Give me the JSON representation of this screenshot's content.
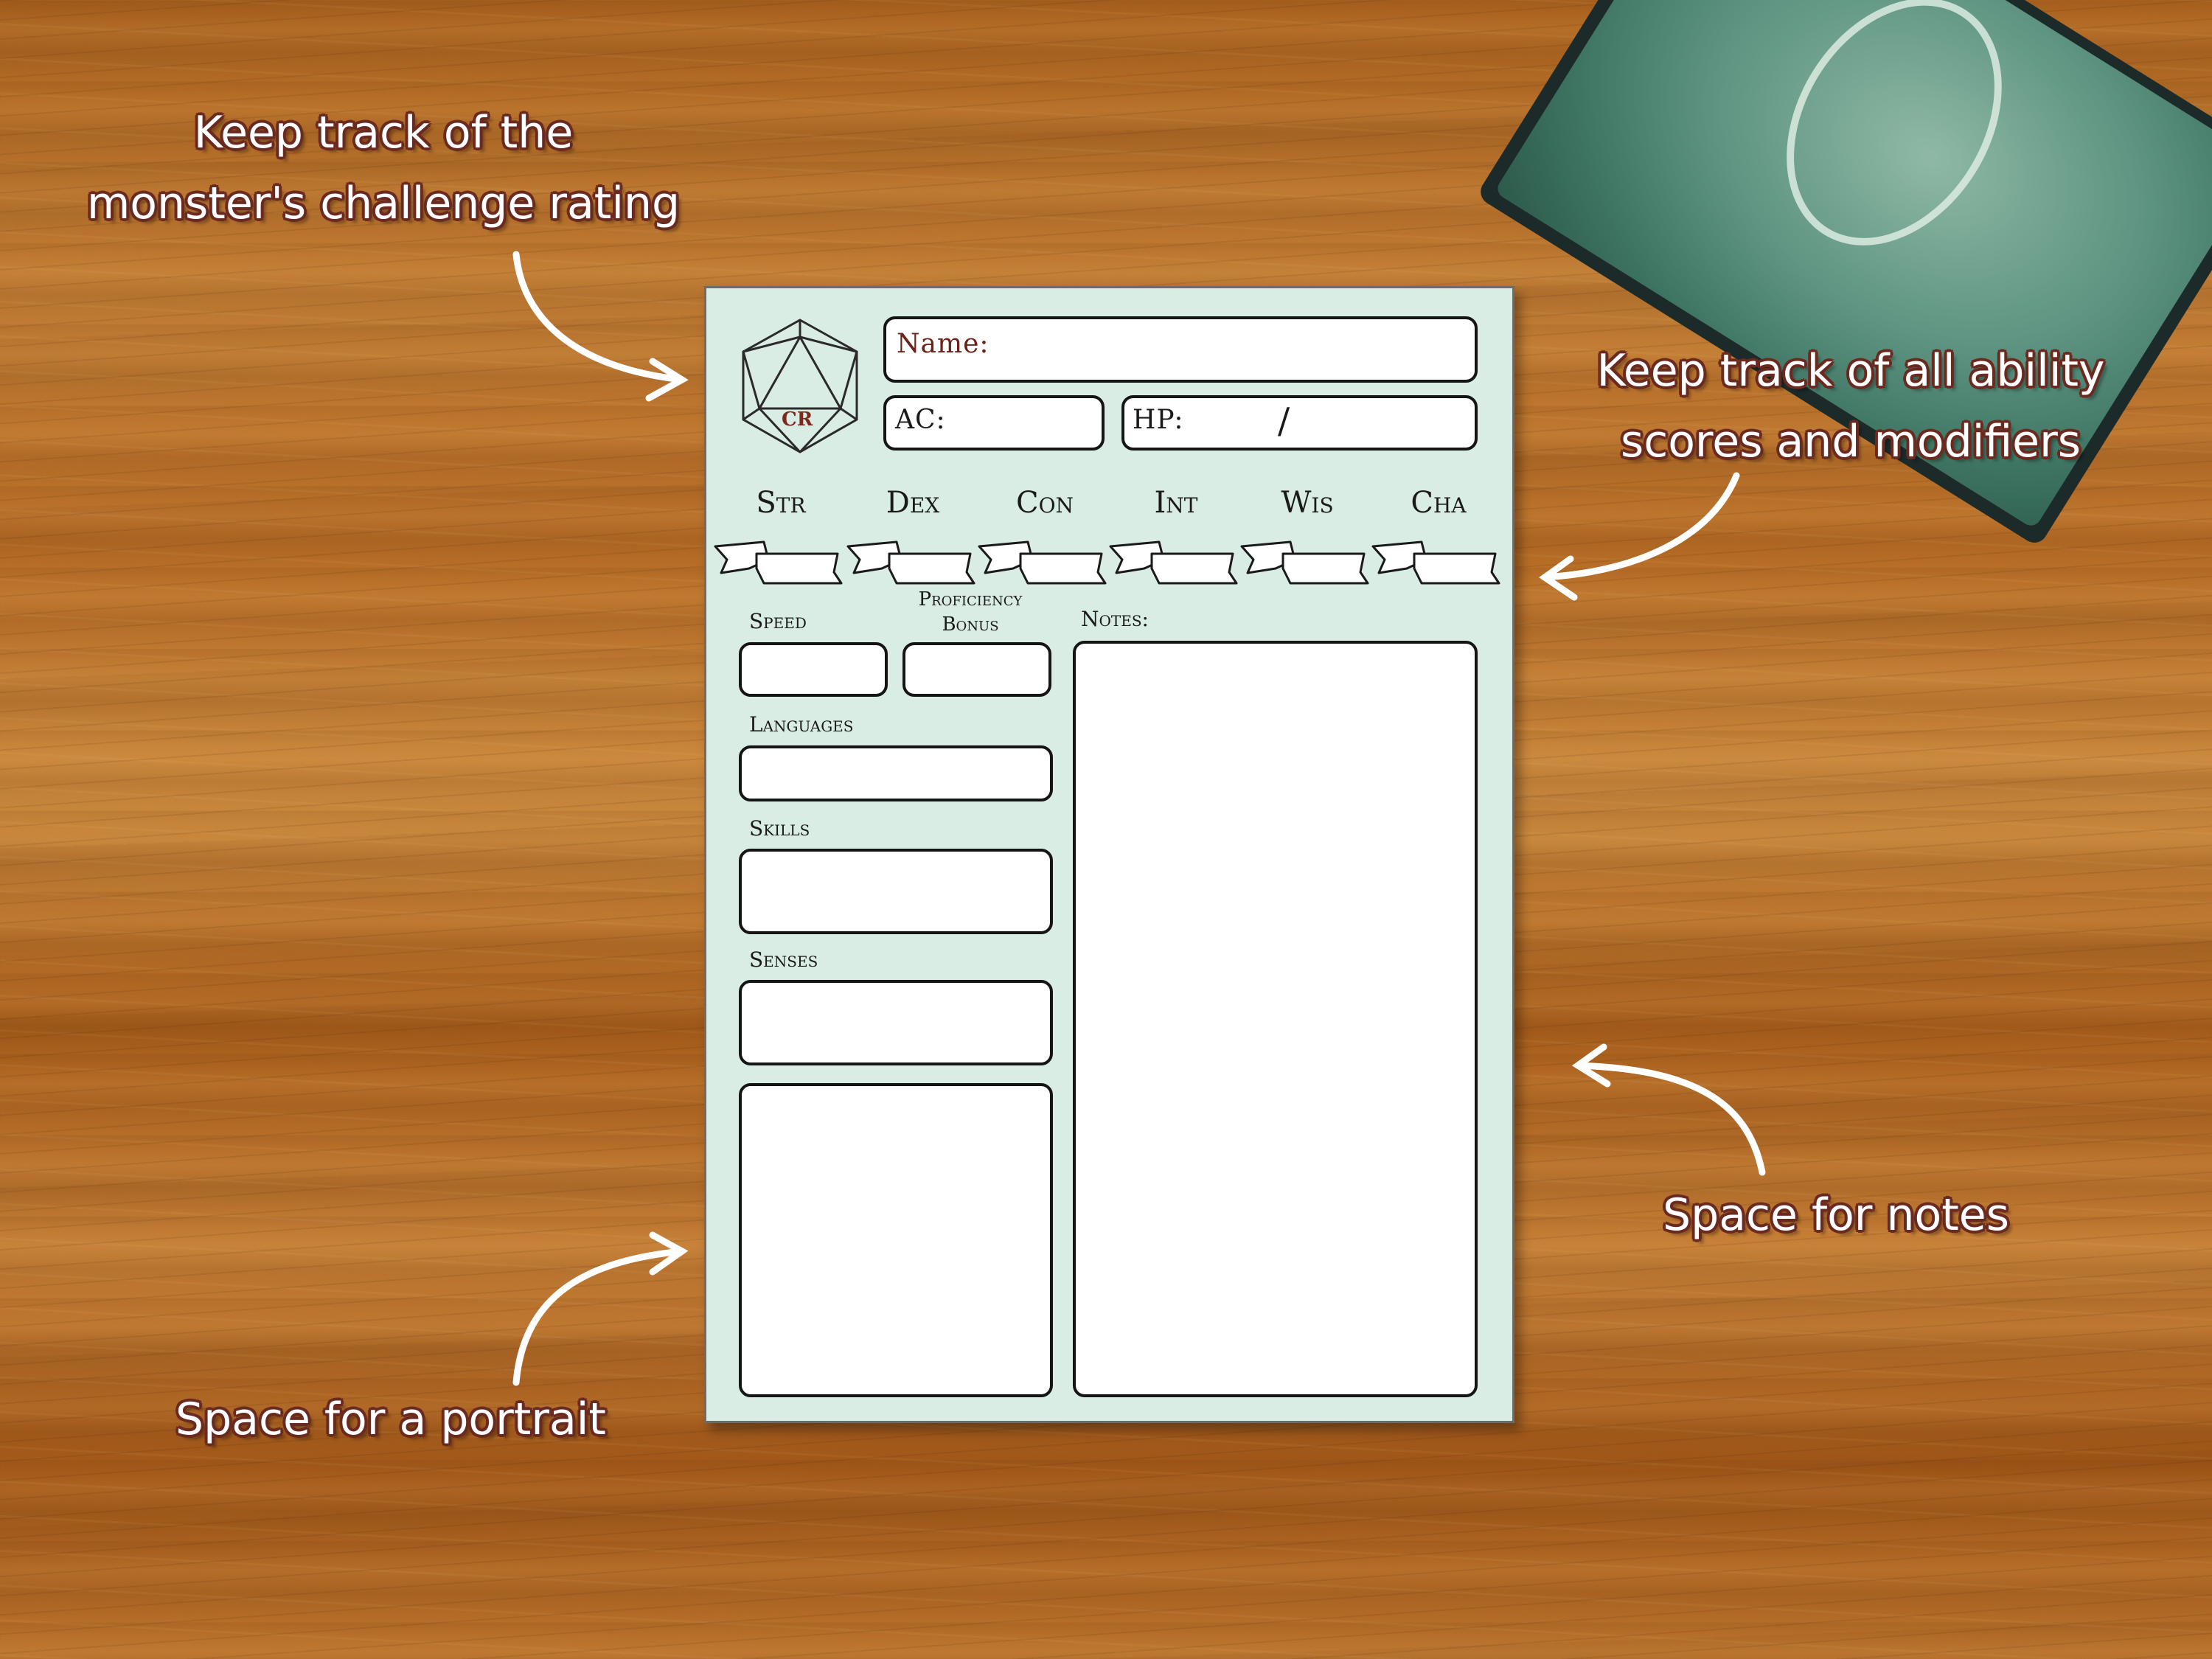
{
  "annotations": {
    "challenge_rating": [
      "Keep track of the",
      "monster's challenge rating"
    ],
    "ability_scores": [
      "Keep track of all ability",
      "scores and modifiers"
    ],
    "portrait": "Space for a portrait",
    "notes": "Space for notes"
  },
  "sheet": {
    "cr_label": "CR",
    "name_label": "Name:",
    "ac_label": "AC:",
    "hp_label": "HP:",
    "hp_separator": "/",
    "abilities": [
      "Str",
      "Dex",
      "Con",
      "Int",
      "Wis",
      "Cha"
    ],
    "speed_label": "Speed",
    "proficiency_label": [
      "Proficiency",
      "Bonus"
    ],
    "notes_label": "Notes:",
    "languages_label": "Languages",
    "skills_label": "Skills",
    "senses_label": "Senses"
  },
  "colors": {
    "sheet_bg": "#daede5",
    "label_red": "#6a2219",
    "annotation_outline": "#6b2a20"
  }
}
